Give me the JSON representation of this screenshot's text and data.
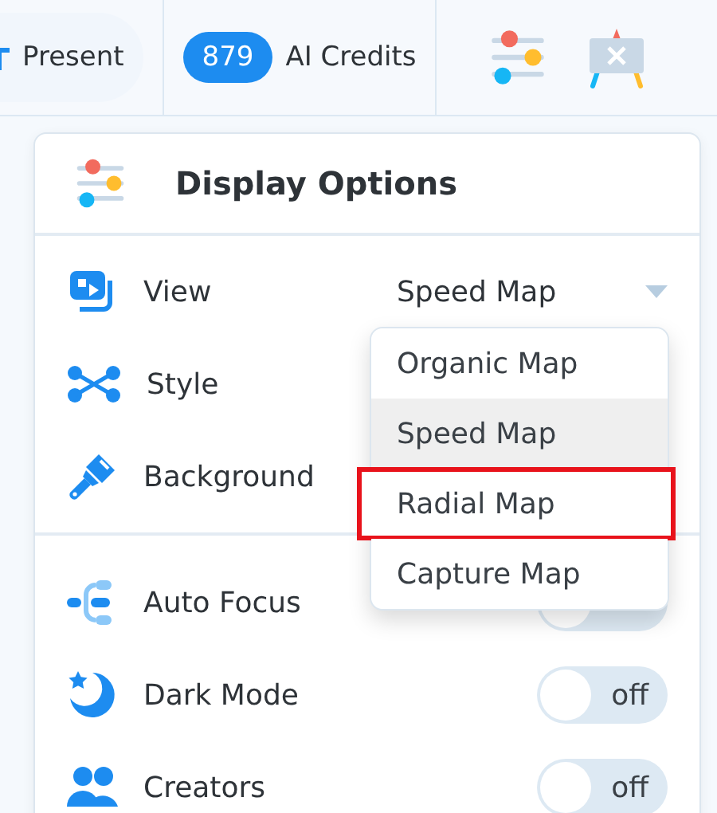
{
  "toolbar": {
    "present": {
      "label": "Present"
    },
    "credits": {
      "count": "879",
      "label": "AI Credits"
    }
  },
  "panel": {
    "title": "Display Options",
    "rows": [
      {
        "kind": "select",
        "label": "View",
        "value": "Speed Map"
      },
      {
        "kind": "plain",
        "label": "Style"
      },
      {
        "kind": "plain",
        "label": "Background"
      },
      {
        "kind": "toggle",
        "label": "Auto Focus",
        "on": false
      },
      {
        "kind": "toggle",
        "label": "Dark Mode",
        "on": false,
        "state_text": "off"
      },
      {
        "kind": "toggle",
        "label": "Creators",
        "on": false,
        "state_text": "off"
      }
    ],
    "menu": [
      {
        "label": "Organic Map",
        "selected": false,
        "highlighted": false
      },
      {
        "label": "Speed Map",
        "selected": true,
        "highlighted": false
      },
      {
        "label": "Radial Map",
        "selected": false,
        "highlighted": true
      },
      {
        "label": "Capture Map",
        "selected": false,
        "highlighted": false
      }
    ]
  }
}
